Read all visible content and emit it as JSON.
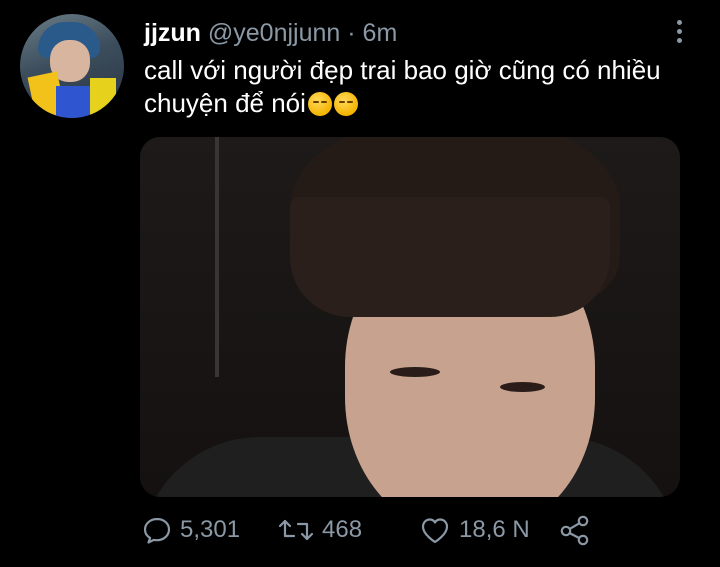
{
  "tweet": {
    "display_name": "jjzun",
    "handle": "@ye0njjunn",
    "separator": "·",
    "time": "6m",
    "text": "call với người đẹp trai bao giờ cũng có nhiều chuyện để nói",
    "emojis": [
      "pensive-face",
      "relieved-face"
    ]
  },
  "actions": {
    "replies": "5,301",
    "retweets": "468",
    "likes": "18,6 N"
  },
  "colors": {
    "background": "#000000",
    "text": "#ffffff",
    "muted": "#8b98a5"
  }
}
